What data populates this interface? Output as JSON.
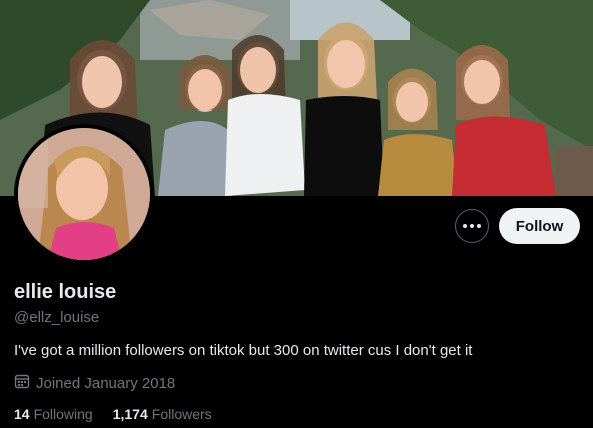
{
  "profile": {
    "display_name": "ellie louise",
    "handle": "@ellz_louise",
    "bio": "I've got a million followers on tiktok but 300 on twitter cus I don't get it",
    "joined": "Joined January 2018",
    "following_count": "14",
    "following_label": "Following",
    "followers_count": "1,174",
    "followers_label": "Followers"
  },
  "actions": {
    "follow_label": "Follow",
    "more_icon": "more-horizontal-icon"
  },
  "icons": {
    "joined": "calendar-icon"
  },
  "colors": {
    "background": "#000000",
    "primary_text": "#e7e9ea",
    "secondary_text": "#71767b",
    "follow_button_bg": "#eff3f4",
    "border": "#536471"
  }
}
